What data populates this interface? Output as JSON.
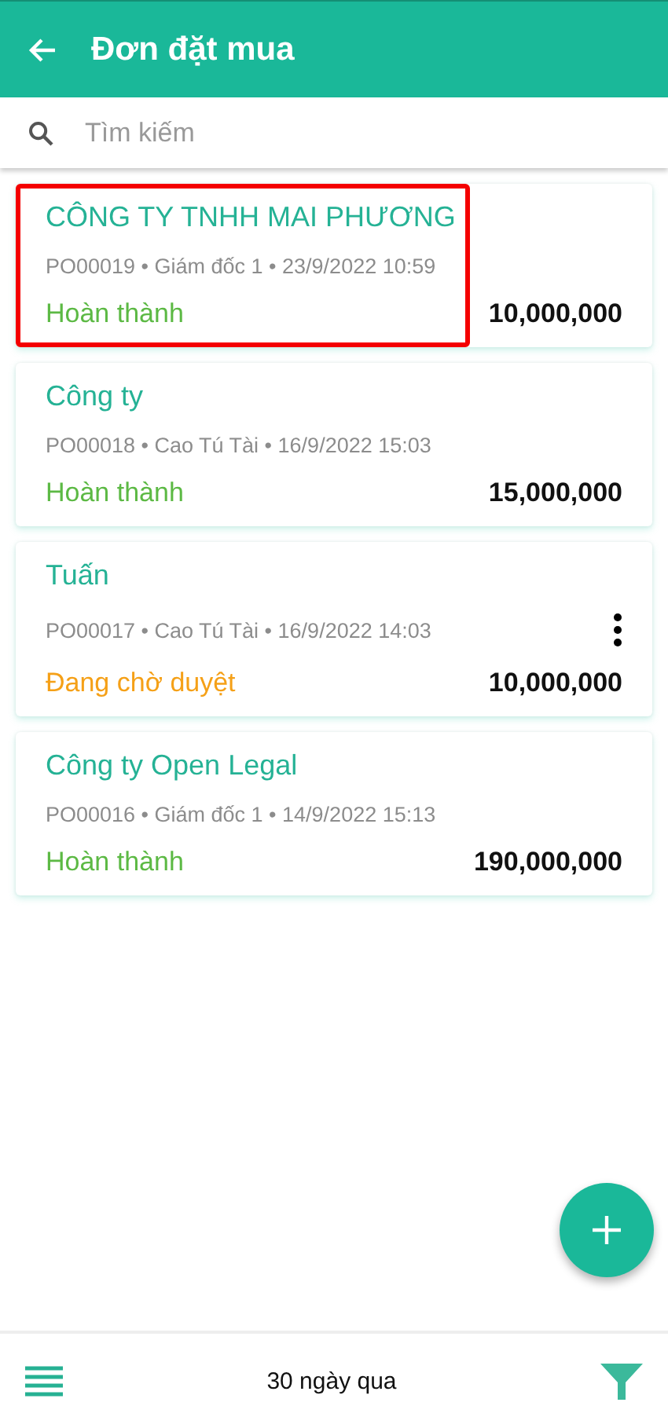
{
  "header": {
    "title": "Đơn đặt mua"
  },
  "search": {
    "placeholder": "Tìm kiếm"
  },
  "orders": [
    {
      "name": "CÔNG TY TNHH MAI PHƯƠNG",
      "meta": "PO00019 • Giám đốc 1 • 23/9/2022 10:59",
      "status": "Hoàn thành",
      "kind": "done",
      "amount": "10,000,000",
      "highlighted": true,
      "menu_shown": false
    },
    {
      "name": "Công ty",
      "meta": "PO00018 • Cao Tú Tài • 16/9/2022 15:03",
      "status": "Hoàn thành",
      "kind": "done",
      "amount": "15,000,000",
      "highlighted": false,
      "menu_shown": false
    },
    {
      "name": "Tuấn",
      "meta": "PO00017 • Cao Tú Tài • 16/9/2022 14:03",
      "status": "Đang chờ duyệt",
      "kind": "pending",
      "amount": "10,000,000",
      "highlighted": false,
      "menu_shown": true
    },
    {
      "name": "Công ty Open Legal",
      "meta": "PO00016 • Giám đốc 1 • 14/9/2022 15:13",
      "status": "Hoàn thành",
      "kind": "done",
      "amount": "190,000,000",
      "highlighted": false,
      "menu_shown": false
    }
  ],
  "bottom_bar": {
    "period": "30 ngày qua"
  }
}
